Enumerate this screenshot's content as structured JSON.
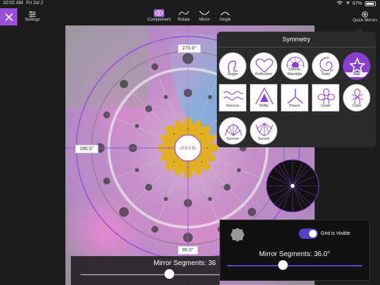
{
  "status_bar": {
    "time": "10:02 AM",
    "date": "Fri Jul 2",
    "battery": "97%"
  },
  "toolbar": {
    "settings_label": "Settings",
    "complement_label": "Complement",
    "rotate_label": "Rotate",
    "mirror_label": "Mirror",
    "single_label": "Single",
    "quick_mirrors_label": "Quick Mirrors"
  },
  "canvas": {
    "angle_top": "270.0°",
    "angle_left": "180.0°",
    "angle_bottom": "90.0°",
    "center_coord": "(0.5,0.5)",
    "accent_color": "#9b4fd9"
  },
  "symmetry": {
    "title": "Symmetry",
    "options": [
      {
        "label": "Single",
        "icon": "single-icon"
      },
      {
        "label": "Reflection",
        "icon": "heart-icon"
      },
      {
        "label": "Classic Mandala",
        "icon": "mandala-icon"
      },
      {
        "label": "Swirl",
        "icon": "swirl-icon"
      },
      {
        "label": "Star",
        "icon": "star-icon",
        "selected": true
      },
      {
        "label": "Horizon",
        "icon": "horizon-icon"
      },
      {
        "label": "Delta",
        "icon": "delta-icon"
      },
      {
        "label": "Peace",
        "icon": "peace-icon"
      },
      {
        "label": "Quad",
        "icon": "quad-icon"
      },
      {
        "label": "Card",
        "icon": "card-icon"
      },
      {
        "label": "Sunrise",
        "icon": "sunrise-icon"
      },
      {
        "label": "Sunset",
        "icon": "sunset-icon"
      }
    ]
  },
  "grid_panel": {
    "grid_label": "Grid is Visible",
    "grid_visible": true,
    "mirror_segments_label": "Mirror Segments: 36.0°",
    "slider_value": 36.0
  },
  "bottom_bar": {
    "mirror_segments_label": "Mirror Segments: 36"
  }
}
